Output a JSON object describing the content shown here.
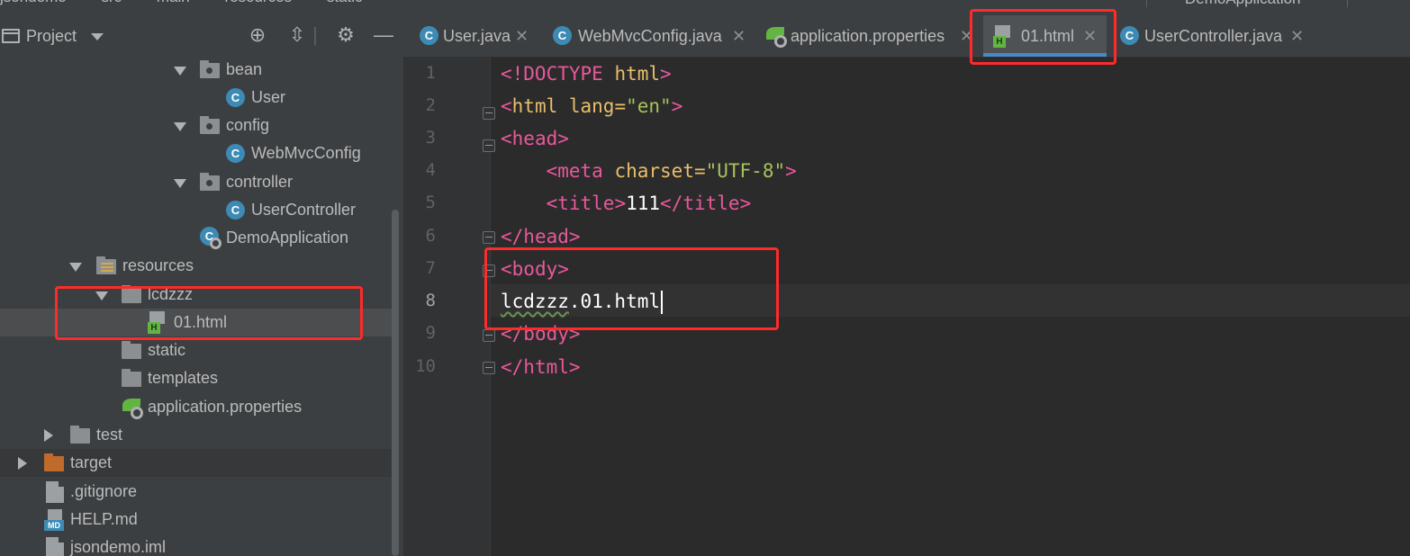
{
  "breadcrumb": {
    "items": [
      "jsondemo",
      "src",
      "main",
      "resources",
      "static"
    ]
  },
  "run_config": {
    "label": "DemoApplication"
  },
  "project_panel": {
    "title": "Project",
    "tree": [
      {
        "label": "bean",
        "type": "package",
        "expanded": true
      },
      {
        "label": "User",
        "type": "class"
      },
      {
        "label": "config",
        "type": "package",
        "expanded": true
      },
      {
        "label": "WebMvcConfig",
        "type": "class"
      },
      {
        "label": "controller",
        "type": "package",
        "expanded": true
      },
      {
        "label": "UserController",
        "type": "class"
      },
      {
        "label": "DemoApplication",
        "type": "spring-boot-class"
      },
      {
        "label": "resources",
        "type": "resources-folder",
        "expanded": true
      },
      {
        "label": "lcdzzz",
        "type": "folder",
        "expanded": true
      },
      {
        "label": "01.html",
        "type": "html-file",
        "selected": true
      },
      {
        "label": "static",
        "type": "folder"
      },
      {
        "label": "templates",
        "type": "folder"
      },
      {
        "label": "application.properties",
        "type": "spring-properties"
      },
      {
        "label": "test",
        "type": "folder",
        "expanded": false
      },
      {
        "label": "target",
        "type": "excluded-folder",
        "expanded": false
      },
      {
        "label": ".gitignore",
        "type": "ignore-file"
      },
      {
        "label": "HELP.md",
        "type": "markdown-file"
      },
      {
        "label": "jsondemo.iml",
        "type": "iml-file"
      }
    ]
  },
  "tabs": [
    {
      "label": "User.java",
      "icon": "class-icon",
      "active": false
    },
    {
      "label": "WebMvcConfig.java",
      "icon": "class-icon",
      "active": false
    },
    {
      "label": "application.properties",
      "icon": "spring-properties-icon",
      "active": false
    },
    {
      "label": "01.html",
      "icon": "html-file-icon",
      "active": true
    },
    {
      "label": "UserController.java",
      "icon": "class-icon",
      "active": false
    }
  ],
  "editor": {
    "current_line": 8,
    "line_numbers": [
      "1",
      "2",
      "3",
      "4",
      "5",
      "6",
      "7",
      "8",
      "9",
      "10"
    ],
    "lines": [
      {
        "p1": "<!DOCTYPE ",
        "p2": "html",
        "p3": ">"
      },
      {
        "open": "<",
        "tag": "html",
        "attr": " lang=",
        "val": "\"en\"",
        "close": ">"
      },
      {
        "open": "<",
        "tag": "head",
        "close": ">"
      },
      {
        "indent": "    ",
        "open": "<",
        "tag": "meta",
        "attr": " charset=",
        "val": "\"UTF-8\"",
        "close": ">"
      },
      {
        "indent": "    ",
        "open": "<",
        "tag": "title",
        "close": ">",
        "text": "111",
        "endopen": "</",
        "endtag": "title",
        "endclose": ">"
      },
      {
        "open": "</",
        "tag": "head",
        "close": ">"
      },
      {
        "open": "<",
        "tag": "body",
        "close": ">"
      },
      {
        "squiggly": "lcdzzz",
        "text": ".01.html"
      },
      {
        "open": "</",
        "tag": "body",
        "close": ">"
      },
      {
        "open": "</",
        "tag": "html",
        "close": ">"
      }
    ]
  },
  "colors": {
    "highlight_box": "#ff2a2a",
    "active_tab_underline": "#4a88c7",
    "html_tag": "#e8bf6a",
    "string_value": "#a5c25c"
  }
}
